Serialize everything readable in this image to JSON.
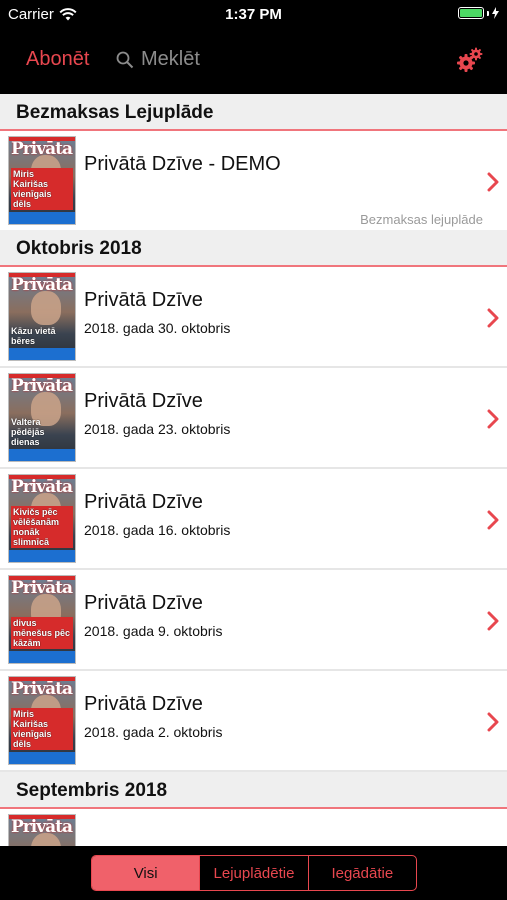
{
  "status_bar": {
    "carrier": "Carrier",
    "time": "1:37 PM"
  },
  "nav": {
    "subscribe_label": "Abonēt",
    "search_placeholder": "Meklēt"
  },
  "sections": [
    {
      "title": "Bezmaksas Lejuplāde",
      "items": [
        {
          "title": "Privātā Dzīve - DEMO",
          "date": "",
          "note": "Bezmaksas lejuplāde",
          "cover_masthead": "Privāta",
          "cover_headline": "Miris Kairišas vienīgais dēls"
        }
      ]
    },
    {
      "title": "Oktobris 2018",
      "items": [
        {
          "title": "Privātā Dzīve",
          "date": "2018. gada 30. oktobris",
          "note": "",
          "cover_masthead": "Privāta",
          "cover_headline": "Kāzu vietā bēres"
        },
        {
          "title": "Privātā Dzīve",
          "date": "2018. gada 23. oktobris",
          "note": "",
          "cover_masthead": "Privāta",
          "cover_headline": "Valtera pēdējās dienas"
        },
        {
          "title": "Privātā Dzīve",
          "date": "2018. gada 16. oktobris",
          "note": "",
          "cover_masthead": "Privāta",
          "cover_headline": "Kivičs pēc vēlēšanām nonāk slimnīcā"
        },
        {
          "title": "Privātā Dzīve",
          "date": "2018. gada 9. oktobris",
          "note": "",
          "cover_masthead": "Privāta",
          "cover_headline": "divus mēnešus pēc kāzām"
        },
        {
          "title": "Privātā Dzīve",
          "date": "2018. gada 2. oktobris",
          "note": "",
          "cover_masthead": "Privāta",
          "cover_headline": "Miris Kairišas vienīgais dēls"
        }
      ]
    },
    {
      "title": "Septembris 2018",
      "items": [
        {
          "title": "",
          "date": "",
          "note": "",
          "cover_masthead": "Privāta",
          "cover_headline": ""
        }
      ]
    }
  ],
  "filter": {
    "segments": [
      "Visi",
      "Lejuplādētie",
      "Iegādātie"
    ],
    "selected": "Visi"
  },
  "colors": {
    "accent": "#e8474f",
    "segment_active": "#f0616a",
    "cover_red": "#d62b2b",
    "cover_blue": "#1c6fd0",
    "battery": "#4cd964"
  },
  "icons": {
    "wifi": "wifi-icon",
    "battery": "battery-icon",
    "search": "search-icon",
    "settings": "gear-icon",
    "disclosure": "chevron-right-icon"
  }
}
